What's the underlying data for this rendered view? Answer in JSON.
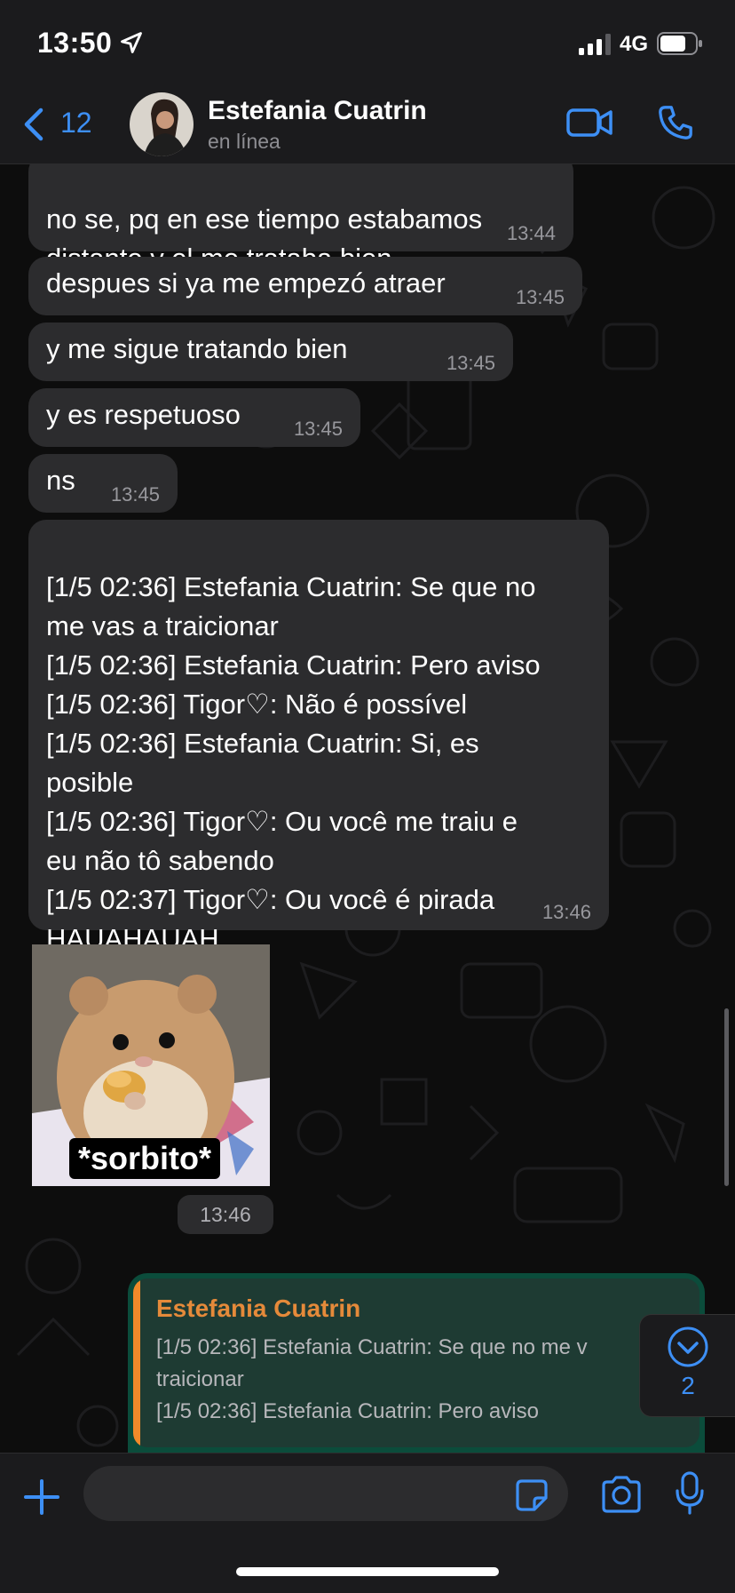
{
  "status_bar": {
    "time": "13:50",
    "network": "4G"
  },
  "header": {
    "back_count": "12",
    "contact_name": "Estefania Cuatrin",
    "contact_status": "en línea"
  },
  "messages": [
    {
      "text": "no se, pq en ese tiempo estabamos\ndistante y el me trataba bien",
      "time": "13:44"
    },
    {
      "text": "despues si ya me empezó atraer",
      "time": "13:45"
    },
    {
      "text": "y me sigue tratando bien",
      "time": "13:45"
    },
    {
      "text": "y es respetuoso",
      "time": "13:45"
    },
    {
      "text": "ns",
      "time": "13:45"
    },
    {
      "text": "[1/5 02:36] Estefania Cuatrin: Se que no\nme vas a traicionar\n[1/5 02:36] Estefania Cuatrin: Pero aviso\n[1/5 02:36] Tigor♡: Não é possível\n[1/5 02:36] Estefania Cuatrin: Si, es\nposible\n[1/5 02:36] Tigor♡: Ou você me traiu e\neu não tô sabendo\n[1/5 02:37] Tigor♡: Ou você é pirada\nHAUAHAUAH",
      "time": "13:46"
    }
  ],
  "sticker": {
    "caption": "*sorbito*",
    "time": "13:46"
  },
  "reply": {
    "quoted_name": "Estefania Cuatrin",
    "quoted_text": "[1/5 02:36] Estefania Cuatrin: Se que no me v\ntraicionar\n[1/5 02:36] Estefania Cuatrin: Pero aviso"
  },
  "scroll_fab": {
    "unread_count": "2"
  },
  "input": {
    "placeholder": "",
    "value": ""
  },
  "colors": {
    "accent": "#3d8ff5",
    "incoming_bubble": "#2c2c2e",
    "outgoing_bubble": "#0b4c3b",
    "quote_bar": "#f08a2a",
    "quote_name": "#e58a3a"
  }
}
